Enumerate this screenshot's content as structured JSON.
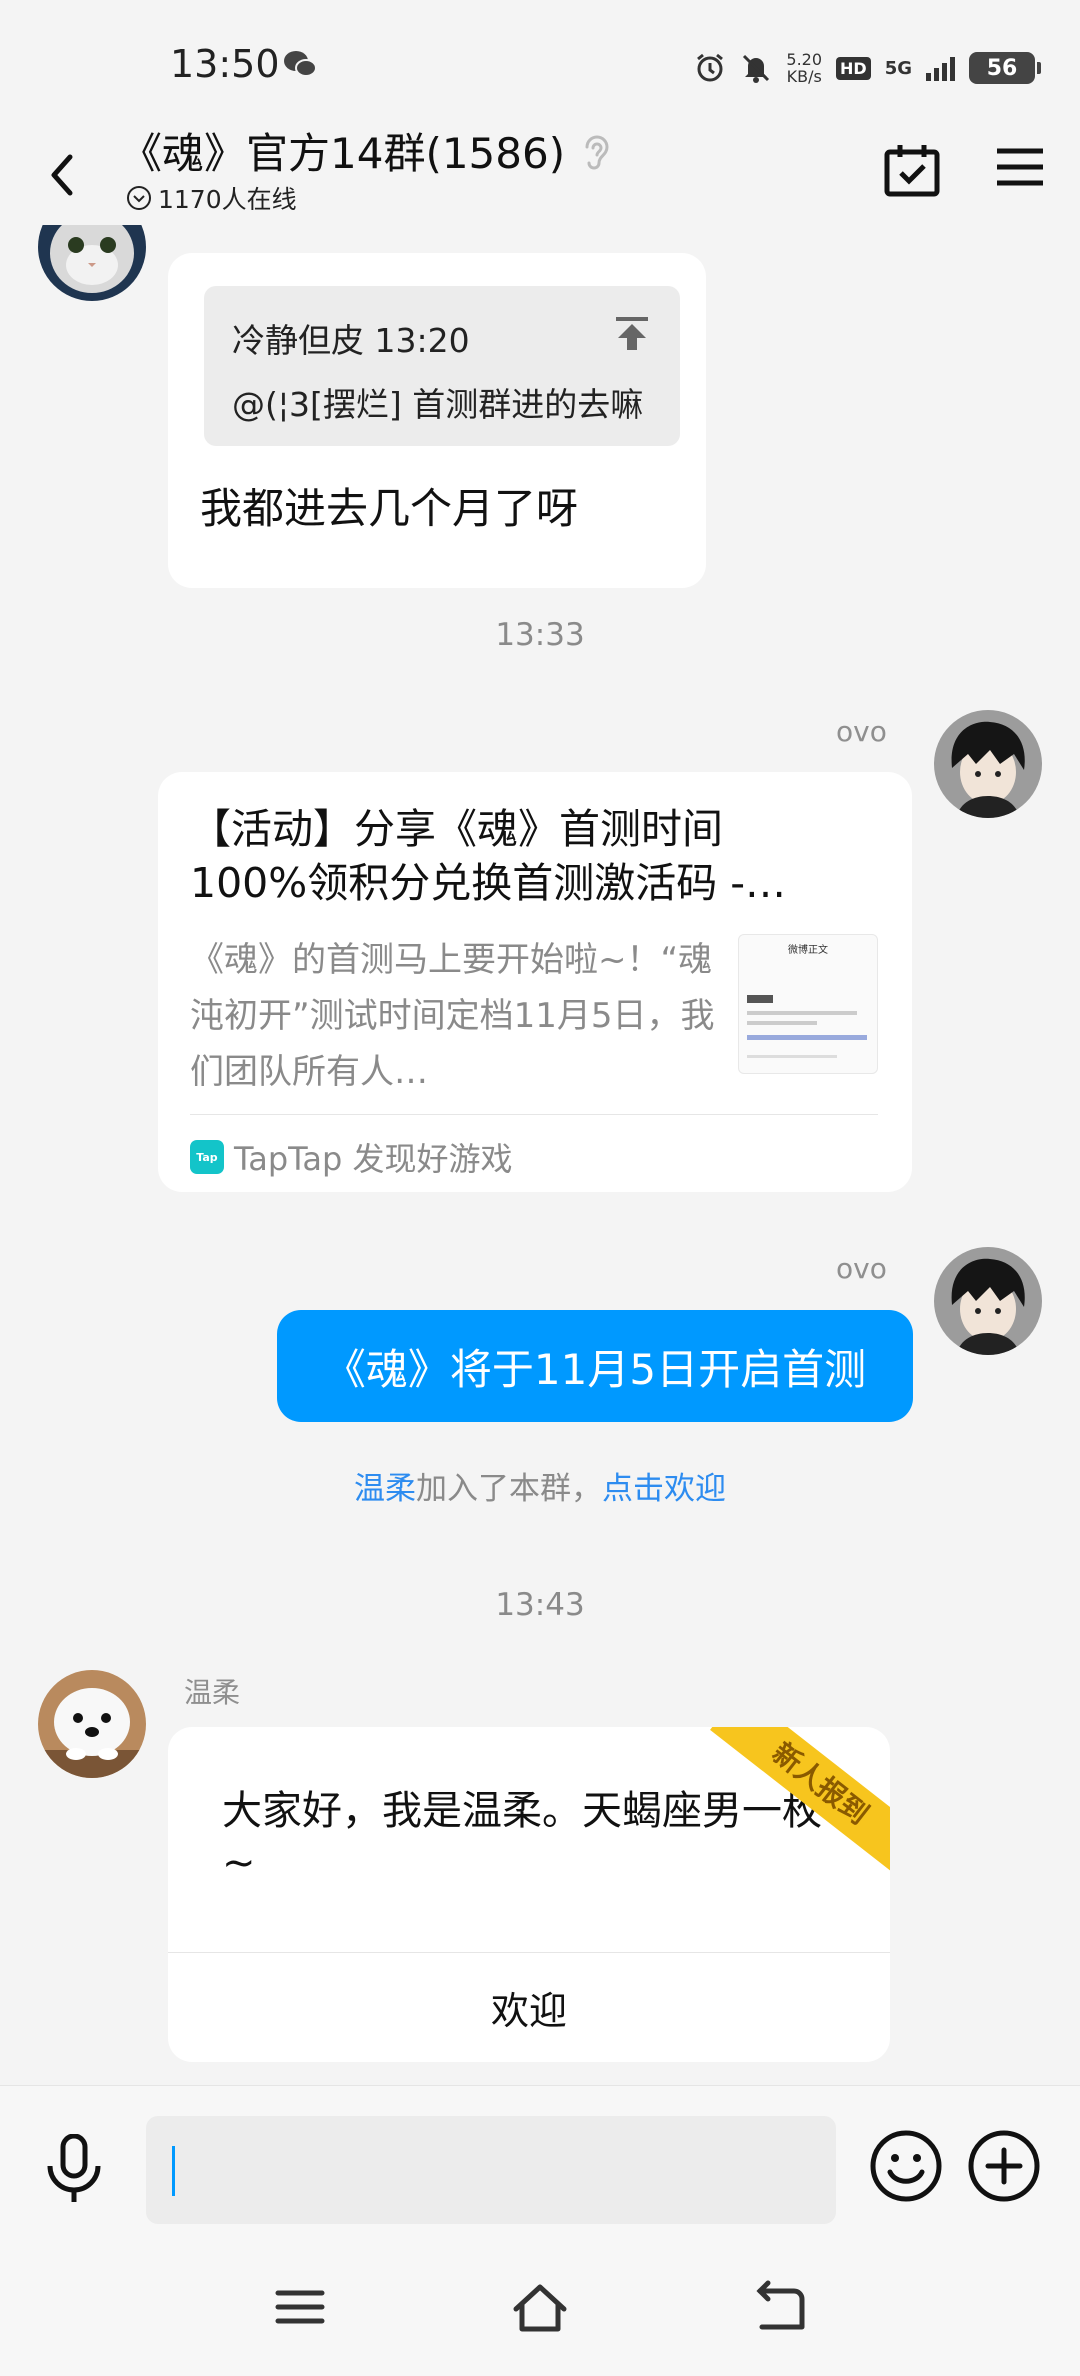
{
  "status_bar": {
    "time": "13:50",
    "net_speed_value": "5.20",
    "net_speed_unit": "KB/s",
    "hd_label": "HD",
    "network_label": "5G",
    "battery_level": "56",
    "icons": [
      "wechat-icon",
      "alarm-icon",
      "mute-icon",
      "signal-icon",
      "battery-icon"
    ]
  },
  "header": {
    "title": "《魂》官方14群(1586)",
    "online_status": "1170人在线"
  },
  "messages": {
    "reply": {
      "quote_author_time": "冷静但皮 13:20",
      "quote_text": "@(¦3[摆烂] 首测群进的去嘛",
      "text": "我都进去几个月了呀"
    },
    "time1": "13:33",
    "card": {
      "sender": "ovo",
      "title_line1": "【活动】分享《魂》首测时间",
      "title_line2": "100%领积分兑换首测激活码 -…",
      "desc": "《魂》的首测马上要开始啦~！“魂沌初开”测试时间定档11月5日，我们团队所有人…",
      "thumb_title": "微博正文",
      "source_logo": "Tap",
      "source": "TapTap 发现好游戏"
    },
    "blue": {
      "sender": "ovo",
      "text": "《魂》将于11月5日开启首测"
    },
    "system": {
      "name": "温柔",
      "middle": "加入了本群，",
      "link": "点击欢迎"
    },
    "time2": "13:43",
    "newbie": {
      "sender": "温柔",
      "text": "大家好，我是温柔。天蝎座男一枚~",
      "ribbon": "新人报到",
      "button": "欢迎"
    }
  },
  "input": {
    "placeholder": ""
  },
  "colors": {
    "accent_blue": "#0099ff",
    "link_blue": "#2d8cf0",
    "ribbon_yellow": "#f7c51e",
    "background": "#f4f4f4"
  }
}
